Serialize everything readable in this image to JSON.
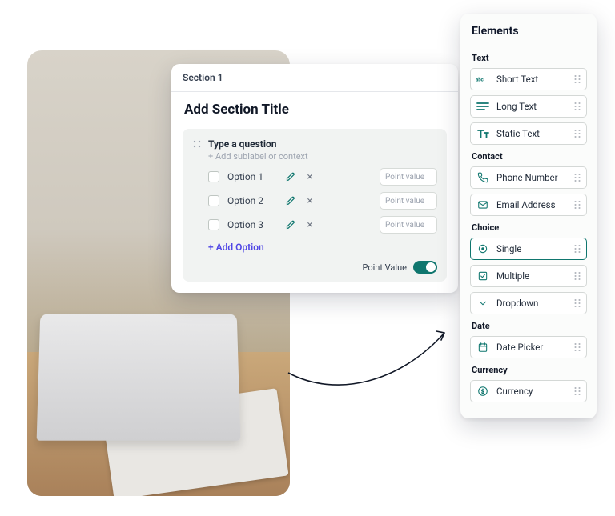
{
  "builder": {
    "section_label": "Section 1",
    "title": "Add Section Title",
    "question_prompt": "Type a question",
    "sublabel_prompt": "+ Add sublabel or context",
    "options": [
      {
        "label": "Option 1",
        "point_placeholder": "Point value"
      },
      {
        "label": "Option 2",
        "point_placeholder": "Point value"
      },
      {
        "label": "Option 3",
        "point_placeholder": "Point value"
      }
    ],
    "add_option_label": "+ Add Option",
    "point_value_label": "Point Value",
    "point_value_on": true
  },
  "elements": {
    "title": "Elements",
    "groups": [
      {
        "label": "Text",
        "items": [
          {
            "id": "short-text",
            "label": "Short Text",
            "icon": "abc"
          },
          {
            "id": "long-text",
            "label": "Long Text",
            "icon": "lines"
          },
          {
            "id": "static-text",
            "label": "Static Text",
            "icon": "tt"
          }
        ]
      },
      {
        "label": "Contact",
        "items": [
          {
            "id": "phone",
            "label": "Phone Number",
            "icon": "phone"
          },
          {
            "id": "email",
            "label": "Email Address",
            "icon": "mail"
          }
        ]
      },
      {
        "label": "Choice",
        "items": [
          {
            "id": "single",
            "label": "Single",
            "icon": "radio",
            "active": true
          },
          {
            "id": "multiple",
            "label": "Multiple",
            "icon": "check"
          },
          {
            "id": "dropdown",
            "label": "Dropdown",
            "icon": "chev"
          }
        ]
      },
      {
        "label": "Date",
        "items": [
          {
            "id": "date",
            "label": "Date Picker",
            "icon": "cal"
          }
        ]
      },
      {
        "label": "Currency",
        "items": [
          {
            "id": "currency",
            "label": "Currency",
            "icon": "dollar"
          }
        ]
      }
    ]
  }
}
